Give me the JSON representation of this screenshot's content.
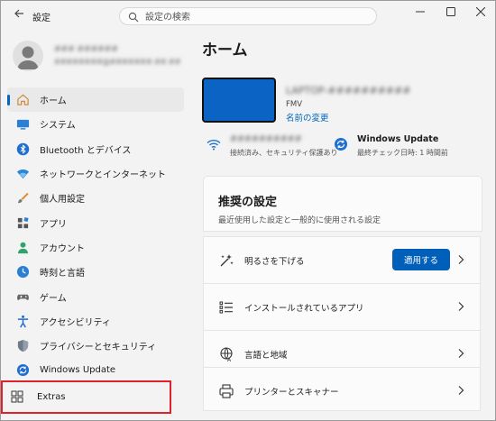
{
  "window": {
    "title": "設定"
  },
  "search": {
    "placeholder": "設定の検索"
  },
  "profile": {
    "name": "### ######",
    "email": "########@#######.##.##"
  },
  "nav": {
    "items": [
      {
        "label": "ホーム",
        "icon": "home-icon",
        "selected": true
      },
      {
        "label": "システム",
        "icon": "system-icon"
      },
      {
        "label": "Bluetooth とデバイス",
        "icon": "bluetooth-icon"
      },
      {
        "label": "ネットワークとインターネット",
        "icon": "network-icon"
      },
      {
        "label": "個人用設定",
        "icon": "personalization-icon"
      },
      {
        "label": "アプリ",
        "icon": "apps-icon"
      },
      {
        "label": "アカウント",
        "icon": "accounts-icon"
      },
      {
        "label": "時刻と言語",
        "icon": "time-language-icon"
      },
      {
        "label": "ゲーム",
        "icon": "gaming-icon"
      },
      {
        "label": "アクセシビリティ",
        "icon": "accessibility-icon"
      },
      {
        "label": "プライバシーとセキュリティ",
        "icon": "privacy-shield-icon"
      },
      {
        "label": "Windows Update",
        "icon": "windows-update-icon"
      }
    ],
    "extras_label": "Extras"
  },
  "main": {
    "title": "ホーム",
    "device": {
      "name": "LAPTOP-##########",
      "model": "FMV",
      "rename_link": "名前の変更"
    },
    "network": {
      "title": "##########",
      "subtitle": "接続済み、セキュリティ保護あり"
    },
    "update": {
      "title": "Windows Update",
      "subtitle": "最終チェック日時: 1 時間前"
    },
    "recommended": {
      "title": "推奨の設定",
      "subtitle": "最近使用した設定と一般的に使用される設定",
      "items": [
        {
          "label": "明るさを下げる",
          "button": "適用する"
        },
        {
          "label": "インストールされているアプリ"
        },
        {
          "label": "言語と地域"
        },
        {
          "label": "プリンターとスキャナー"
        }
      ]
    }
  },
  "colors": {
    "accent": "#0067c0",
    "button": "#005fb8",
    "highlight": "#e0202a",
    "device": "#0b63c4"
  }
}
